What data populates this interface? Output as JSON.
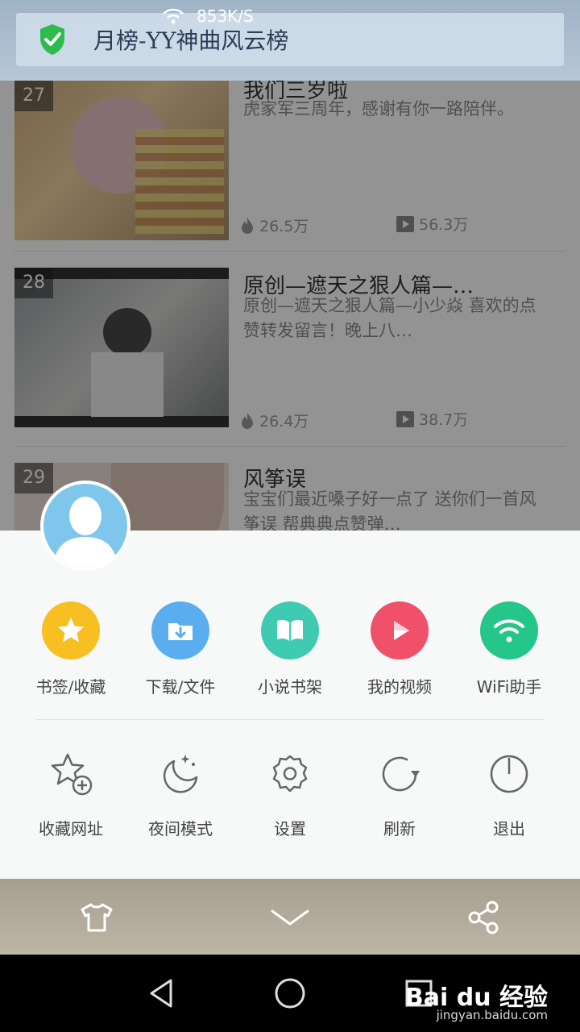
{
  "status": {
    "net_speed": "853K/S"
  },
  "notification": {
    "title": "月榜-YY神曲风云榜"
  },
  "list": {
    "items": [
      {
        "rank": "27",
        "title": "我们三岁啦",
        "desc": "虎家军三周年，感谢有你一路陪伴。",
        "likes": "26.5万",
        "plays": "56.3万"
      },
      {
        "rank": "28",
        "title": "原创—遮天之狠人篇—…",
        "desc": "原创—遮天之狠人篇—小少焱 喜欢的点赞转发留言！晚上八…",
        "likes": "26.4万",
        "plays": "38.7万"
      },
      {
        "rank": "29",
        "title": "风筝误",
        "desc": "宝宝们最近嗓子好一点了 送你们一首风筝误 帮典典点赞弹…",
        "likes": "",
        "plays": ""
      }
    ]
  },
  "menu": {
    "row1": [
      {
        "label": "书签/收藏",
        "icon": "star-icon",
        "color": "#f8bf22"
      },
      {
        "label": "下载/文件",
        "icon": "download-folder-icon",
        "color": "#5aaef0"
      },
      {
        "label": "小说书架",
        "icon": "book-icon",
        "color": "#3fcbb1"
      },
      {
        "label": "我的视频",
        "icon": "play-icon",
        "color": "#f1506a"
      },
      {
        "label": "WiFi助手",
        "icon": "wifi-icon",
        "color": "#24c68a"
      }
    ],
    "row2": [
      {
        "label": "收藏网址",
        "icon": "star-add-icon"
      },
      {
        "label": "夜间模式",
        "icon": "moon-icon"
      },
      {
        "label": "设置",
        "icon": "gear-icon"
      },
      {
        "label": "刷新",
        "icon": "refresh-icon"
      },
      {
        "label": "退出",
        "icon": "power-icon"
      }
    ]
  },
  "toolbar": {
    "items": [
      "shirt-icon",
      "chevron-down-icon",
      "share-icon"
    ]
  },
  "watermark": {
    "brand": "Bai du 经验",
    "url": "jingyan.baidu.com"
  }
}
